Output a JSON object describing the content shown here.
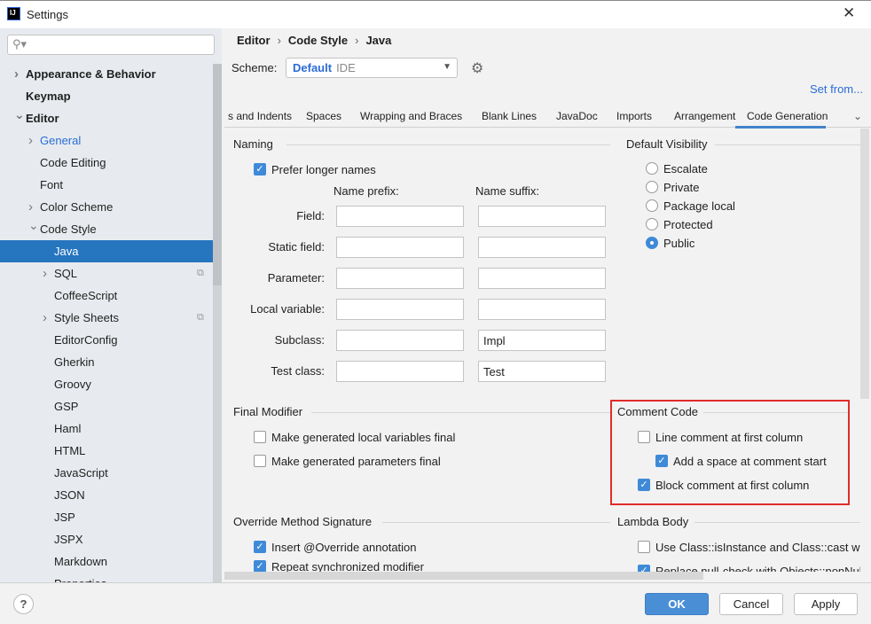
{
  "window": {
    "title": "Settings",
    "logo": "IJ"
  },
  "sidebar": {
    "search_placeholder": "",
    "items": [
      {
        "label": "Appearance & Behavior",
        "level": 0,
        "bold": true,
        "chevron": "right"
      },
      {
        "label": "Keymap",
        "level": 0,
        "bold": true
      },
      {
        "label": "Editor",
        "level": 0,
        "bold": true,
        "chevron": "down"
      },
      {
        "label": "General",
        "level": 1,
        "chevron": "right",
        "color": "#2a6cd6"
      },
      {
        "label": "Code Editing",
        "level": 1
      },
      {
        "label": "Font",
        "level": 1
      },
      {
        "label": "Color Scheme",
        "level": 1,
        "chevron": "right"
      },
      {
        "label": "Code Style",
        "level": 1,
        "chevron": "down"
      },
      {
        "label": "Java",
        "level": 2,
        "selected": true
      },
      {
        "label": "SQL",
        "level": 2,
        "chevron": "right",
        "copy_icon": true
      },
      {
        "label": "CoffeeScript",
        "level": 2
      },
      {
        "label": "Style Sheets",
        "level": 2,
        "chevron": "right",
        "copy_icon": true
      },
      {
        "label": "EditorConfig",
        "level": 2
      },
      {
        "label": "Gherkin",
        "level": 2
      },
      {
        "label": "Groovy",
        "level": 2
      },
      {
        "label": "GSP",
        "level": 2
      },
      {
        "label": "Haml",
        "level": 2
      },
      {
        "label": "HTML",
        "level": 2
      },
      {
        "label": "JavaScript",
        "level": 2
      },
      {
        "label": "JSON",
        "level": 2
      },
      {
        "label": "JSP",
        "level": 2
      },
      {
        "label": "JSPX",
        "level": 2
      },
      {
        "label": "Markdown",
        "level": 2
      },
      {
        "label": "Properties",
        "level": 2
      }
    ]
  },
  "breadcrumb": [
    "Editor",
    "Code Style",
    "Java"
  ],
  "scheme": {
    "label": "Scheme:",
    "name": "Default",
    "type": "IDE",
    "set_from": "Set from..."
  },
  "tabs": [
    {
      "label": "s and Indents"
    },
    {
      "label": "Spaces"
    },
    {
      "label": "Wrapping and Braces"
    },
    {
      "label": "Blank Lines"
    },
    {
      "label": "JavaDoc"
    },
    {
      "label": "Imports"
    },
    {
      "label": "Arrangement"
    },
    {
      "label": "Code Generation",
      "active": true
    }
  ],
  "naming": {
    "title": "Naming",
    "prefer_longer": {
      "label": "Prefer longer names",
      "checked": true
    },
    "prefix_header": "Name prefix:",
    "suffix_header": "Name suffix:",
    "rows": [
      {
        "label": "Field:",
        "prefix": "",
        "suffix": ""
      },
      {
        "label": "Static field:",
        "prefix": "",
        "suffix": ""
      },
      {
        "label": "Parameter:",
        "prefix": "",
        "suffix": ""
      },
      {
        "label": "Local variable:",
        "prefix": "",
        "suffix": ""
      },
      {
        "label": "Subclass:",
        "prefix": "",
        "suffix": "Impl"
      },
      {
        "label": "Test class:",
        "prefix": "",
        "suffix": "Test"
      }
    ]
  },
  "visibility": {
    "title": "Default Visibility",
    "options": [
      "Escalate",
      "Private",
      "Package local",
      "Protected",
      "Public"
    ],
    "selected": "Public"
  },
  "final_modifier": {
    "title": "Final Modifier",
    "options": [
      {
        "label": "Make generated local variables final",
        "checked": false
      },
      {
        "label": "Make generated parameters final",
        "checked": false
      }
    ]
  },
  "comment_code": {
    "title": "Comment Code",
    "options": [
      {
        "label": "Line comment at first column",
        "checked": false
      },
      {
        "label": "Add a space at comment start",
        "checked": true
      },
      {
        "label": "Block comment at first column",
        "checked": true
      }
    ],
    "highlight_color": "#e32b2b"
  },
  "override": {
    "title": "Override Method Signature",
    "options": [
      {
        "label": "Insert @Override annotation",
        "checked": true
      },
      {
        "label": "Repeat synchronized modifier",
        "checked": true
      }
    ]
  },
  "lambda": {
    "title": "Lambda Body",
    "options": [
      {
        "label": "Use Class::isInstance and Class::cast when",
        "checked": false
      },
      {
        "label": "Replace null-check with Objects::nonNull o",
        "checked": true
      }
    ]
  },
  "buttons": {
    "help": "?",
    "ok": "OK",
    "cancel": "Cancel",
    "apply": "Apply"
  },
  "colors": {
    "accent": "#2675bf",
    "link": "#2a6cd6"
  }
}
